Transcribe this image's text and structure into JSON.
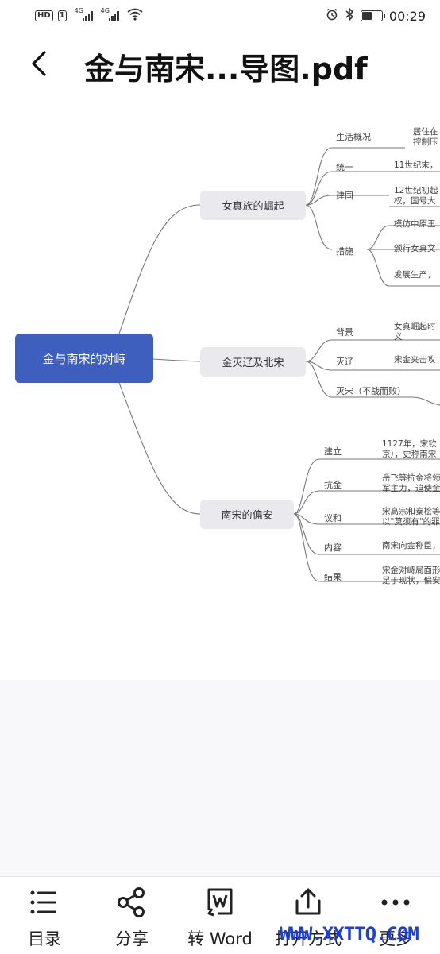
{
  "status_bar": {
    "hd_label": "HD",
    "sim_label": "1",
    "signal1_label": "4G",
    "signal2_label": "4G",
    "time": "00:29"
  },
  "header": {
    "title": "金与南宋...导图.pdf"
  },
  "mindmap": {
    "root": "金与南宋的对峙",
    "branch1": {
      "label": "女真族的崛起",
      "children": [
        {
          "label": "生活概况",
          "detail": "居住在\n控制压"
        },
        {
          "label": "统一",
          "detail": "11世纪末，"
        },
        {
          "label": "建国",
          "detail": "12世纪初起\n权，国号大"
        },
        {
          "label": "措施",
          "details": [
            "模仿中原王",
            "颁行女真文",
            "发展生产，"
          ]
        }
      ]
    },
    "branch2": {
      "label": "金灭辽及北宋",
      "children": [
        {
          "label": "背景",
          "detail": "女真崛起时\n义"
        },
        {
          "label": "灭辽",
          "detail": "宋金夹击攻"
        },
        {
          "label": "灭宋（不战而败）",
          "detail": ""
        }
      ]
    },
    "branch3": {
      "label": "南宋的偏安",
      "children": [
        {
          "label": "建立",
          "detail": "1127年，宋钦\n京），史称南宋"
        },
        {
          "label": "抗金",
          "detail": "岳飞等抗金将领\n军主力，迫使金"
        },
        {
          "label": "议和",
          "detail": "宋高宗和秦桧等\n以\"莫须有\"的罪"
        },
        {
          "label": "内容",
          "detail": "南宋向金称臣，"
        },
        {
          "label": "结果",
          "detail": "宋金对峙局面形\n足于现状，偏安"
        }
      ]
    }
  },
  "toolbar": {
    "items": [
      {
        "label": "目录",
        "icon": "list-icon"
      },
      {
        "label": "分享",
        "icon": "share-icon"
      },
      {
        "label": "转 Word",
        "icon": "word-convert-icon"
      },
      {
        "label": "打开方式",
        "icon": "upload-icon"
      },
      {
        "label": "更多",
        "icon": "more-icon"
      }
    ]
  },
  "watermark": "WWW.XXTTQ.COM",
  "colors": {
    "root_node": "#3f5fbf",
    "branch_node": "#e9e9ee",
    "watermark": "#1e3fd6"
  }
}
